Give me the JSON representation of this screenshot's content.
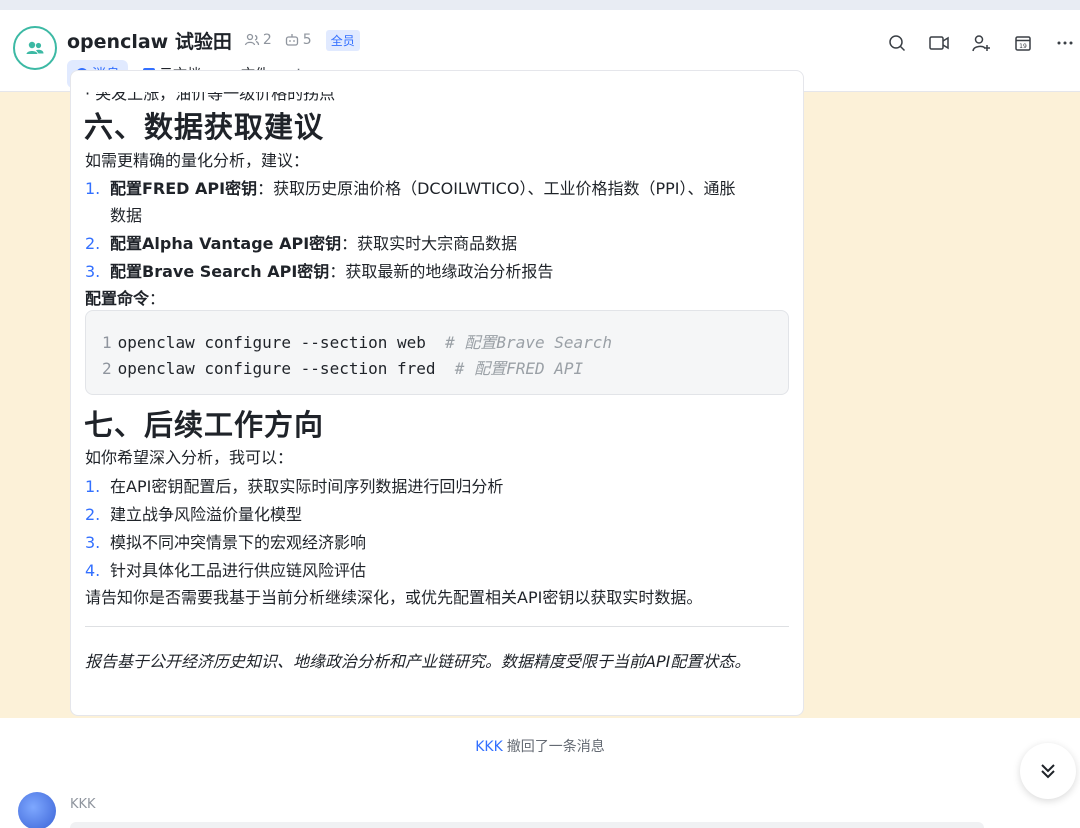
{
  "header": {
    "title": "openclaw 试验田",
    "member_count": "2",
    "bot_count": "5",
    "badge": "全员",
    "tabs": [
      {
        "label": "消息",
        "active": true
      },
      {
        "label": "云文档",
        "active": false
      },
      {
        "label": "文件",
        "active": false
      }
    ],
    "add_tab": "+"
  },
  "message": {
    "clipped_line": "· 突发上涨，油价等一级价格的拐点",
    "section6": {
      "title": "六、数据获取建议",
      "intro": "如需更精确的量化分析，建议：",
      "items": [
        {
          "num": "1.",
          "bold": "配置FRED API密钥",
          "text": "：获取历史原油价格（DCOILWTICO）、工业价格指数（PPI）、通胀",
          "cont": "数据"
        },
        {
          "num": "2.",
          "bold": "配置Alpha Vantage API密钥",
          "text": "：获取实时大宗商品数据"
        },
        {
          "num": "3.",
          "bold": "配置Brave Search API密钥",
          "text": "：获取最新的地缘政治分析报告"
        }
      ],
      "config_label": "配置命令",
      "config_colon": "：",
      "code": [
        {
          "ln": "1",
          "cmd": "openclaw configure --section web  ",
          "comment": "# 配置Brave Search"
        },
        {
          "ln": "2",
          "cmd": "openclaw configure --section fred  ",
          "comment": "# 配置FRED API"
        }
      ]
    },
    "section7": {
      "title": "七、后续工作方向",
      "intro": "如你希望深入分析，我可以：",
      "items": [
        {
          "num": "1.",
          "text": "在API密钥配置后，获取实际时间序列数据进行回归分析"
        },
        {
          "num": "2.",
          "text": "建立战争风险溢价量化模型"
        },
        {
          "num": "3.",
          "text": "模拟不同冲突情景下的宏观经济影响"
        },
        {
          "num": "4.",
          "text": "针对具体化工品进行供应链风险评估"
        }
      ],
      "closing": "请告知你是否需要我基于当前分析继续深化，或优先配置相关API密钥以获取实时数据。"
    },
    "footnote": "报告基于公开经济历史知识、地缘政治分析和产业链研究。数据精度受限于当前API配置状态。"
  },
  "recall": {
    "user": "KKK",
    "text": "撤回了一条消息"
  },
  "next_message": {
    "sender": "KKK"
  },
  "colors": {
    "accent": "#3370ff",
    "chat_bg": "#fcf1d8",
    "group_avatar": "#3cb9a4"
  }
}
